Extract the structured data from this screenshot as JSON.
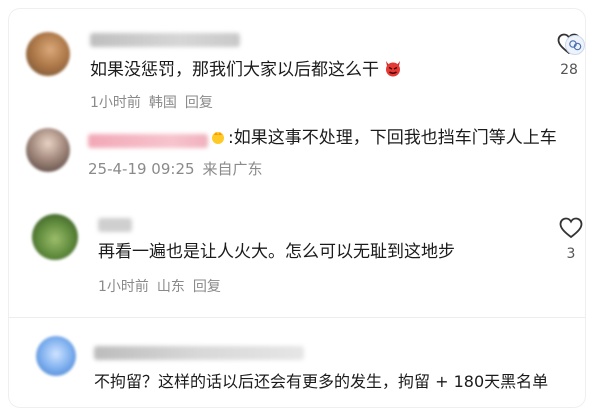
{
  "comments": [
    {
      "text": "如果没惩罚，那我们大家以后都这么干",
      "meta": {
        "time": "1小时前",
        "location": "韩国",
        "reply": "回复"
      },
      "likes": "28"
    },
    {
      "text": ":如果这事不处理，下回我也挡车门等人上车",
      "meta": {
        "time": "25-4-19 09:25",
        "location": "来自广东"
      }
    },
    {
      "text": "再看一遍也是让人火大。怎么可以无耻到这地步",
      "meta": {
        "time": "1小时前",
        "location": "山东",
        "reply": "回复"
      },
      "likes": "3"
    },
    {
      "text": "不拘留？这样的话以后还会有更多的发生，拘留 + 180天黑名单"
    }
  ]
}
